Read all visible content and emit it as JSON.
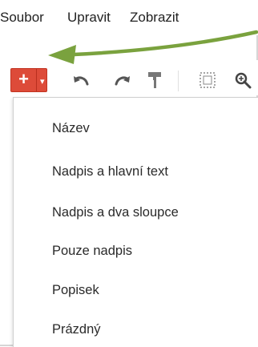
{
  "menubar": {
    "items": [
      "Soubor",
      "Upravit",
      "Zobrazit"
    ]
  },
  "toolbar": {
    "new_label": "+",
    "new_dropdown_glyph": "▾",
    "icons": [
      "undo-icon",
      "redo-icon",
      "paint-format-icon",
      "select-icon",
      "zoom-icon"
    ]
  },
  "layout_menu": {
    "items": [
      "Název",
      "Nadpis a hlavní text",
      "Nadpis a dva sloupce",
      "Pouze nadpis",
      "Popisek",
      "Prázdný"
    ]
  },
  "colors": {
    "new_button": "#dd4b39",
    "annotation_arrow": "#7aa23e"
  }
}
